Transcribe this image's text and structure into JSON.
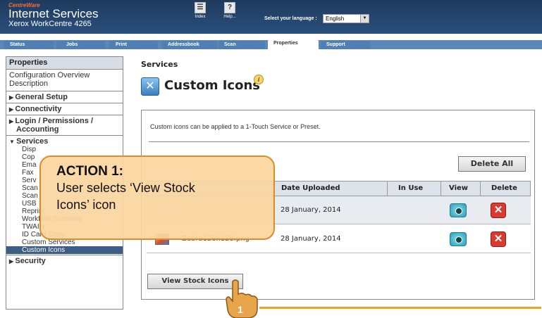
{
  "header": {
    "brand_small": "CentreWare",
    "brand": "Internet Services",
    "model": "Xerox WorkCentre 4265",
    "index_label": "Index",
    "help_label": "Help...",
    "language_label": "Select your language :",
    "language_value": "English"
  },
  "tabs": [
    {
      "label": "Status"
    },
    {
      "label": "Jobs"
    },
    {
      "label": "Print"
    },
    {
      "label": "Addressbook"
    },
    {
      "label": "Scan"
    },
    {
      "label": "Properties"
    },
    {
      "label": "Support"
    }
  ],
  "sidebar": {
    "heading": "Properties",
    "config_overview": "Configuration Overview",
    "description": "Description",
    "general_setup": "General Setup",
    "connectivity": "Connectivity",
    "login_permissions": "Login / Permissions /",
    "accounting": "Accounting",
    "services": "Services",
    "sub_items": [
      {
        "label": "Disp"
      },
      {
        "label": "Cop"
      },
      {
        "label": "Ema"
      },
      {
        "label": "Fax"
      },
      {
        "label": "Serv"
      },
      {
        "label": "Scan"
      },
      {
        "label": "Scan"
      },
      {
        "label": "USB"
      },
      {
        "label": "Reprint"
      },
      {
        "label": "Workflow Scanning"
      },
      {
        "label": "TWAIN"
      },
      {
        "label": "ID Card Copy"
      },
      {
        "label": "Custom Services"
      },
      {
        "label": "Custom Icons"
      }
    ],
    "security": "Security"
  },
  "main": {
    "section": "Services",
    "title": "Custom Icons",
    "description": "Custom icons can be applied to a 1-Touch Service or Preset.",
    "delete_all": "Delete All",
    "columns": [
      "Date Uploaded",
      "In Use",
      "View",
      "Delete"
    ],
    "rows": [
      {
        "name": "",
        "date": "28 January, 2014"
      },
      {
        "name": "Zebra128x128.png",
        "date": "28 January, 2014"
      }
    ],
    "view_stock": "View Stock Icons"
  },
  "overlay": {
    "title": "ACTION 1:",
    "body_line1": "User selects ‘View Stock",
    "body_line2": "Icons’ icon",
    "step": "1"
  }
}
